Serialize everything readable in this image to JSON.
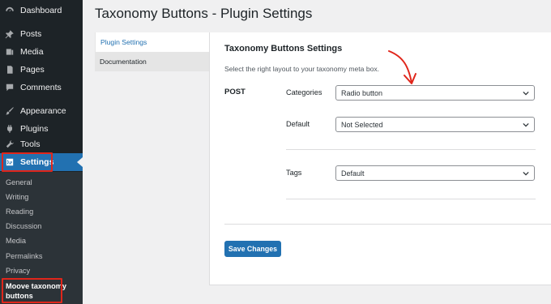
{
  "sidebar": {
    "items": [
      {
        "label": "Dashboard",
        "icon": "dashboard-icon"
      },
      {
        "label": "Posts",
        "icon": "pin-icon"
      },
      {
        "label": "Media",
        "icon": "media-icon"
      },
      {
        "label": "Pages",
        "icon": "pages-icon"
      },
      {
        "label": "Comments",
        "icon": "comment-icon"
      },
      {
        "label": "Appearance",
        "icon": "brush-icon"
      },
      {
        "label": "Plugins",
        "icon": "plug-icon"
      },
      {
        "label": "Tools",
        "icon": "wrench-icon"
      },
      {
        "label": "Settings",
        "icon": "settings-icon"
      }
    ],
    "submenu": [
      "General",
      "Writing",
      "Reading",
      "Discussion",
      "Media",
      "Permalinks",
      "Privacy"
    ],
    "current_sub": [
      "Moove taxonomy",
      "buttons"
    ]
  },
  "page_title": "Taxonomy Buttons - Plugin Settings",
  "tabs": [
    "Plugin Settings",
    "Documentation"
  ],
  "panel": {
    "title": "Taxonomy Buttons Settings",
    "description": "Select the right layout to your taxonomy meta box.",
    "post_type": "POST",
    "fields": [
      {
        "label": "Categories",
        "value": "Radio button"
      },
      {
        "label": "Default",
        "value": "Not Selected"
      },
      {
        "label": "Tags",
        "value": "Default"
      }
    ],
    "save_label": "Save Changes"
  },
  "colors": {
    "accent": "#2271b1",
    "sidebar": "#1d2327",
    "highlight": "#e0261b"
  }
}
